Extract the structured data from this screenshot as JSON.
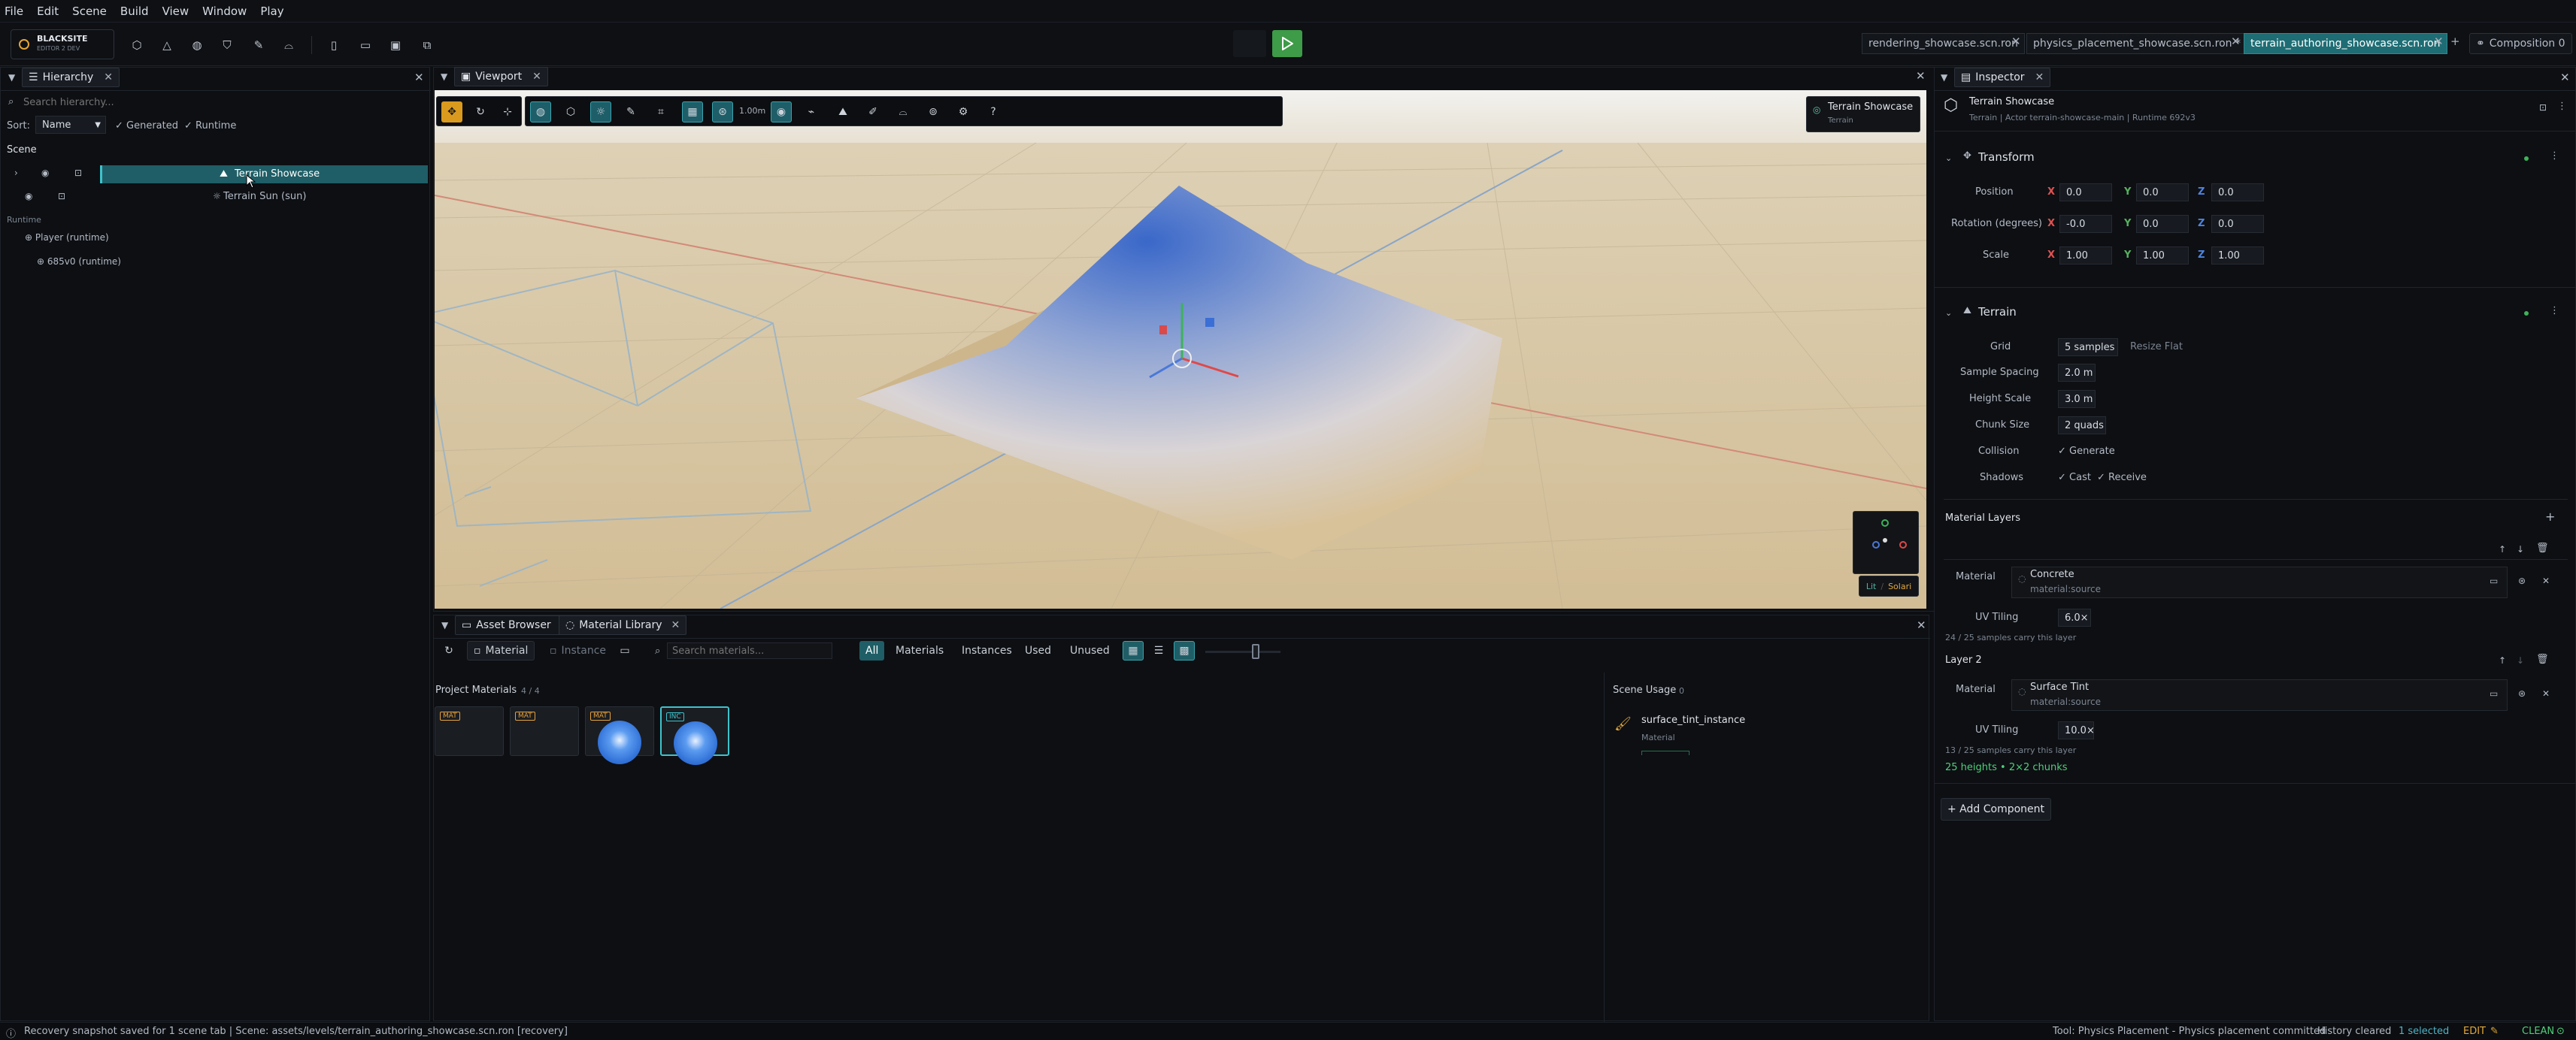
{
  "menu": [
    "File",
    "Edit",
    "Scene",
    "Build",
    "View",
    "Window",
    "Play"
  ],
  "brand": {
    "name": "BLACKSITE",
    "sub": "EDITOR 2 DEV"
  },
  "scene_tabs": [
    {
      "label": "rendering_showcase.scn.ron",
      "active": false
    },
    {
      "label": "physics_placement_showcase.scn.ron *",
      "active": false
    },
    {
      "label": "terrain_authoring_showcase.scn.ron",
      "active": true
    }
  ],
  "new_tab": "+",
  "composition": "Composition 0",
  "hierarchy": {
    "tab": "Hierarchy",
    "search_placeholder": "Search hierarchy...",
    "sort_label": "Sort:",
    "sort_value": "Name",
    "generated": "Generated",
    "runtime": "Runtime",
    "scene_header": "Scene",
    "items": [
      {
        "label": "Terrain Showcase",
        "selected": true
      },
      {
        "label": "Terrain Sun  (sun)",
        "selected": false
      }
    ],
    "runtime_header": "Runtime",
    "runtime_items": [
      "Player  (runtime)",
      "685v0  (runtime)"
    ]
  },
  "viewport": {
    "tab": "Viewport",
    "snap": "1.00m",
    "overlay_title": "Terrain Showcase",
    "overlay_sub": "Terrain",
    "lit": "Lit",
    "solari": "Solari"
  },
  "inspector": {
    "tab": "Inspector",
    "entity_name": "Terrain Showcase",
    "entity_meta": "Terrain  |  Actor terrain-showcase-main  |  Runtime 692v3",
    "transform": {
      "title": "Transform",
      "rows": [
        {
          "label": "Position",
          "x": "0.0",
          "y": "0.0",
          "z": "0.0"
        },
        {
          "label": "Rotation (degrees)",
          "x": "-0.0",
          "y": "0.0",
          "z": "0.0"
        },
        {
          "label": "Scale",
          "x": "1.00",
          "y": "1.00",
          "z": "1.00"
        }
      ]
    },
    "terrain": {
      "title": "Terrain",
      "grid_label": "Grid",
      "grid_value": "5 samples",
      "resize": "Resize Flat",
      "spacing_label": "Sample Spacing",
      "spacing_value": "2.0 m",
      "height_label": "Height Scale",
      "height_value": "3.0 m",
      "chunk_label": "Chunk Size",
      "chunk_value": "2 quads",
      "collision_label": "Collision",
      "collision_value": "Generate",
      "shadows_label": "Shadows",
      "cast": "Cast",
      "receive": "Receive"
    },
    "material_layers": {
      "title": "Material Layers",
      "layers": [
        {
          "name": "",
          "material_label": "Material",
          "material": "Concrete",
          "source": "material:source",
          "uv_label": "UV Tiling",
          "uv": "6.0×",
          "note": "24 / 25 samples carry this layer"
        },
        {
          "name": "Layer 2",
          "material_label": "Material",
          "material": "Surface Tint",
          "source": "material:source",
          "uv_label": "UV Tiling",
          "uv": "10.0×",
          "note": "13 / 25 samples carry this layer"
        }
      ],
      "footer": "25 heights • 2×2 chunks"
    },
    "add_component": "+ Add Component"
  },
  "bottom": {
    "tabs": [
      "Asset Browser",
      "Material Library"
    ],
    "btn_material": "Material",
    "btn_instance": "Instance",
    "search_placeholder": "Search materials...",
    "filters": [
      "All",
      "Materials",
      "Instances",
      "Used",
      "Unused"
    ],
    "project_label": "Project Materials",
    "project_count": "4  /  4",
    "thumbs": [
      "MAT",
      "MAT",
      "MAT",
      "INC"
    ],
    "usage_label": "Scene Usage",
    "usage_count": "0",
    "usage_item": "surface_tint_instance",
    "usage_type": "Material"
  },
  "status": {
    "left": "Recovery snapshot saved for 1 scene tab  |  Scene: assets/levels/terrain_authoring_showcase.scn.ron [recovery]",
    "tool": "Tool: Physics Placement - Physics placement committed",
    "history": "History cleared",
    "selected": "1 selected",
    "mode": "EDIT",
    "clean": "CLEAN"
  },
  "colors": {
    "accent": "#1f6d74",
    "play": "#3e9b47",
    "snap_orange": "#d99a1e"
  }
}
